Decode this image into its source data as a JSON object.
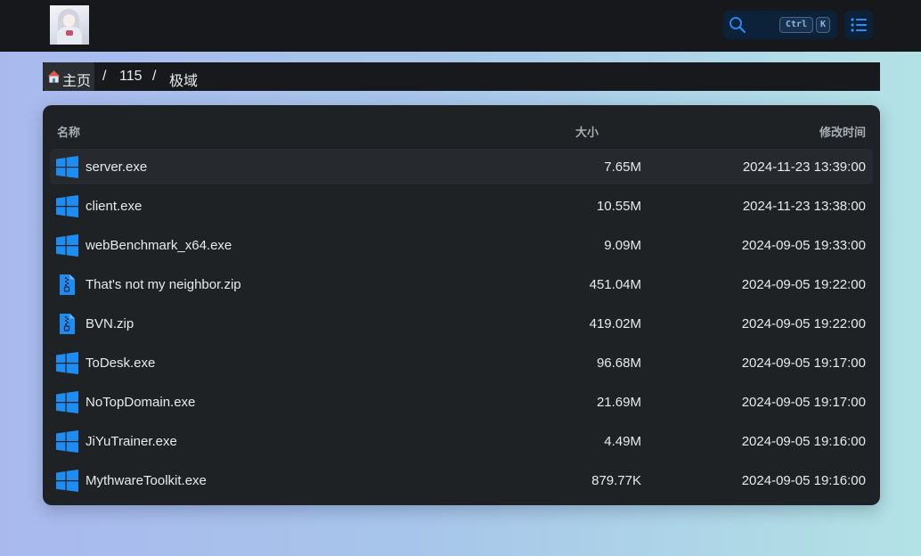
{
  "breadcrumb": {
    "home": "主页",
    "separator": "/",
    "items": [
      "115",
      "极域"
    ]
  },
  "search": {
    "key1": "Ctrl",
    "key2": "K",
    "icon": "search-icon"
  },
  "menu_icon": "list-icon",
  "table": {
    "headers": {
      "name": "名称",
      "size": "大小",
      "time": "修改时间"
    },
    "rows": [
      {
        "name": "server.exe",
        "size": "7.65M",
        "time": "2024-11-23 13:39:00",
        "icon": "windows-icon"
      },
      {
        "name": "client.exe",
        "size": "10.55M",
        "time": "2024-11-23 13:38:00",
        "icon": "windows-icon"
      },
      {
        "name": "webBenchmark_x64.exe",
        "size": "9.09M",
        "time": "2024-09-05 19:33:00",
        "icon": "windows-icon"
      },
      {
        "name": "That's not my neighbor.zip",
        "size": "451.04M",
        "time": "2024-09-05 19:22:00",
        "icon": "zip-file-icon"
      },
      {
        "name": "BVN.zip",
        "size": "419.02M",
        "time": "2024-09-05 19:22:00",
        "icon": "zip-file-icon"
      },
      {
        "name": "ToDesk.exe",
        "size": "96.68M",
        "time": "2024-09-05 19:17:00",
        "icon": "windows-icon"
      },
      {
        "name": "NoTopDomain.exe",
        "size": "21.69M",
        "time": "2024-09-05 19:17:00",
        "icon": "windows-icon"
      },
      {
        "name": "JiYuTrainer.exe",
        "size": "4.49M",
        "time": "2024-09-05 19:16:00",
        "icon": "windows-icon"
      },
      {
        "name": "MythwareToolkit.exe",
        "size": "879.77K",
        "time": "2024-09-05 19:16:00",
        "icon": "windows-icon"
      }
    ]
  },
  "colors": {
    "accent": "#1e90ff",
    "topbar": "#16181b",
    "panel": "#1f2225"
  }
}
